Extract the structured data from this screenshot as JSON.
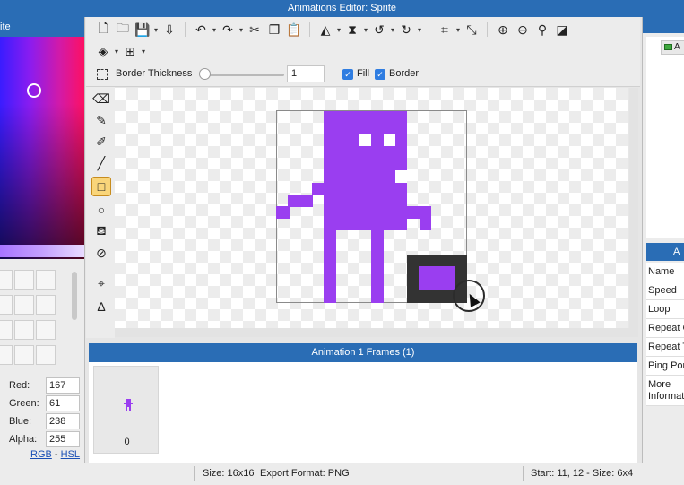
{
  "window": {
    "title": "Animations Editor: Sprite"
  },
  "left_panel": {
    "header": "ite",
    "color": {
      "red_label": "Red:",
      "red": "167",
      "green_label": "Green:",
      "green": "61",
      "blue_label": "Blue:",
      "blue": "238",
      "alpha_label": "Alpha:",
      "alpha": "255"
    },
    "mode_rgb": "RGB",
    "mode_sep": " - ",
    "mode_hsl": "HSL"
  },
  "toolbar": {
    "icons": [
      "new-file-icon",
      "open-folder-icon",
      "save-icon",
      "export-icon",
      "undo-icon",
      "redo-icon",
      "cut-icon",
      "copy-icon",
      "paste-icon",
      "flip-horizontal-icon",
      "flip-vertical-icon",
      "rotate-left-icon",
      "rotate-right-icon",
      "crop-icon",
      "resize-icon",
      "zoom-in-icon",
      "zoom-out-icon",
      "zoom-reset-icon",
      "actual-size-icon",
      "layers-icon",
      "grid-icon"
    ]
  },
  "options": {
    "border_thickness_label": "Border Thickness",
    "border_thickness_value": "1",
    "fill_label": "Fill",
    "fill_checked": true,
    "border_label": "Border",
    "border_checked": true
  },
  "tools": [
    "eraser-icon",
    "pencil-icon",
    "brush-icon",
    "line-icon",
    "rectangle-icon",
    "ellipse-icon",
    "fill-bucket-icon",
    "eyedropper-icon",
    "move-point-icon",
    "node-icon"
  ],
  "active_tool": "rectangle-icon",
  "sprite": {
    "fill_color": "#9a3ef0",
    "border_color": "#333333"
  },
  "frames": {
    "title": "Animation 1 Frames (1)",
    "items": [
      {
        "index": "0"
      }
    ]
  },
  "right_panel": {
    "tree_item": "A",
    "props_header": "A",
    "props": [
      "Name",
      "Speed",
      "Loop",
      "Repeat C",
      "Repeat T",
      "Ping Pon",
      "More Informat"
    ]
  },
  "status": {
    "size": "Size: 16x16",
    "export": "Export Format: PNG",
    "selection": "Start: 11, 12 - Size: 6x4"
  }
}
